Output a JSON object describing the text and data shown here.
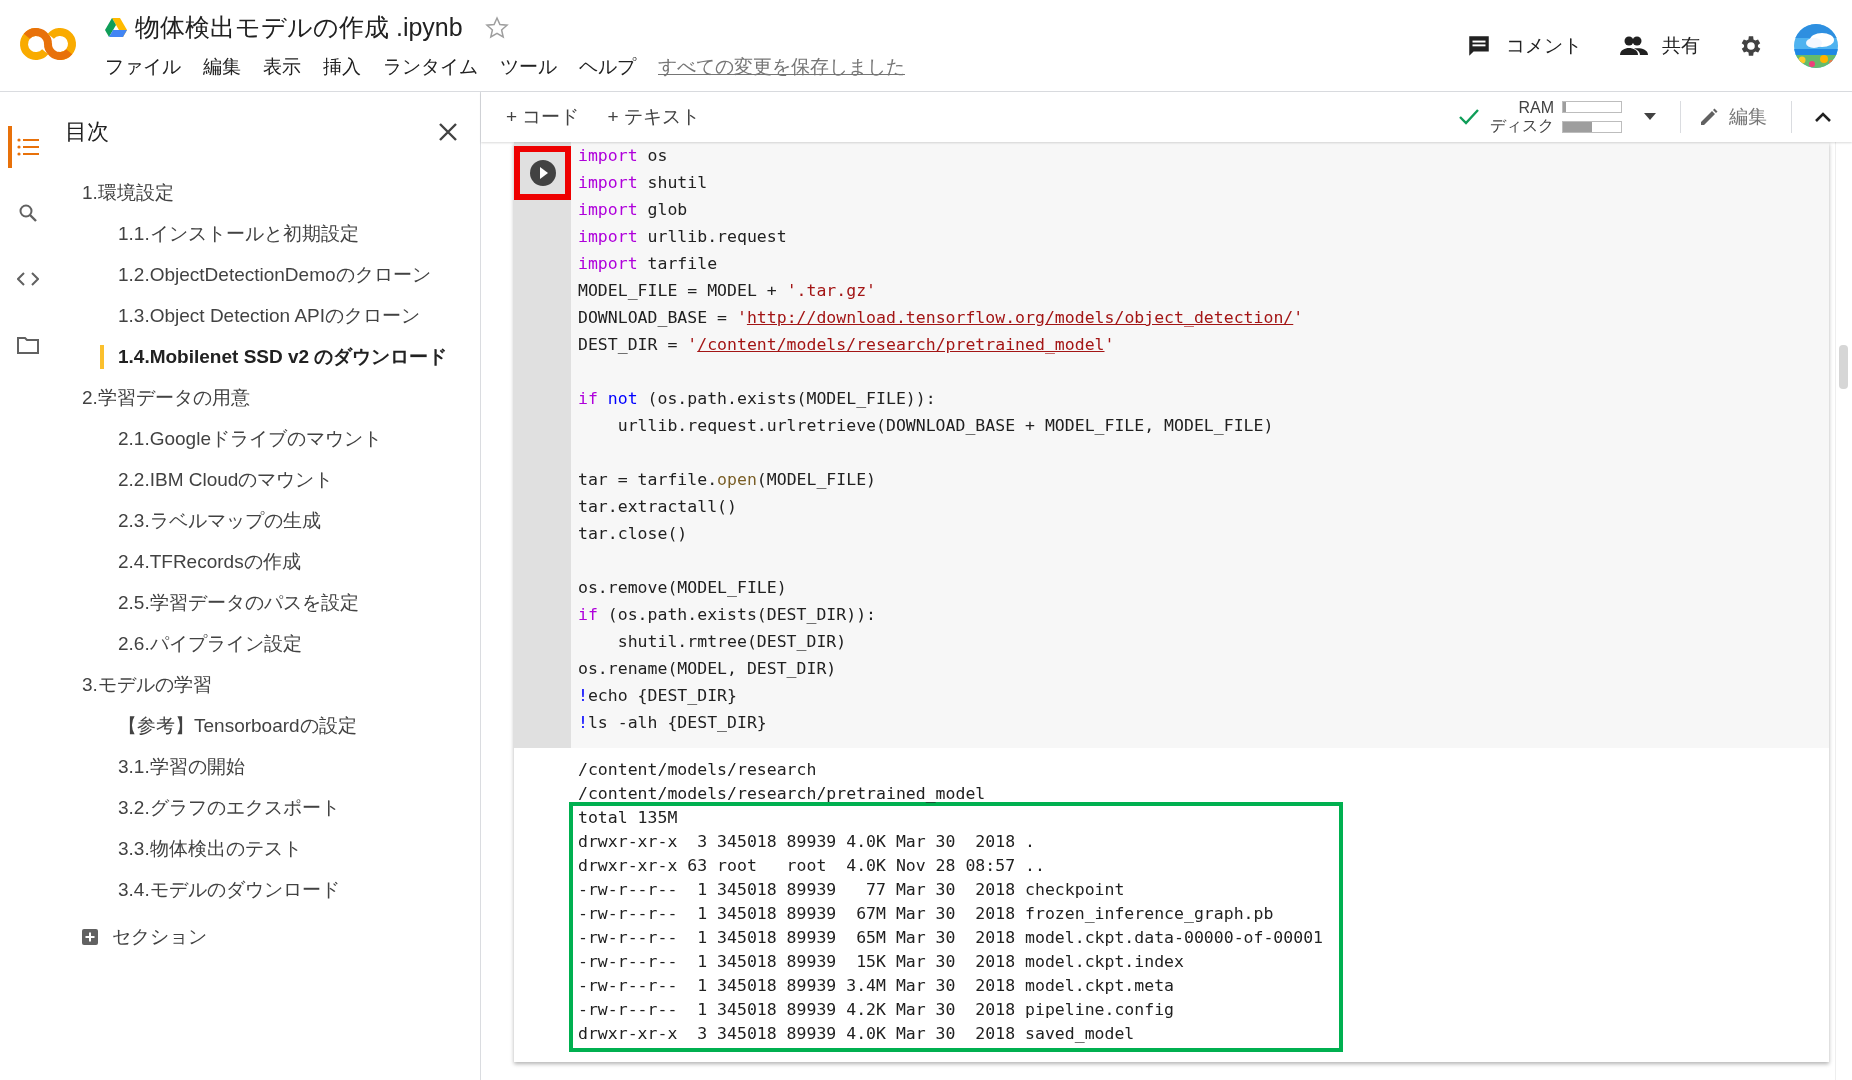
{
  "header": {
    "title": "物体検出モデルの作成 .ipynb",
    "starred": false,
    "menu": [
      "ファイル",
      "編集",
      "表示",
      "挿入",
      "ランタイム",
      "ツール",
      "ヘルプ"
    ],
    "save_status": "すべての変更を保存しました",
    "actions": [
      {
        "kind": "comment",
        "label": "コメント"
      },
      {
        "kind": "share",
        "label": "共有"
      },
      {
        "kind": "settings"
      }
    ]
  },
  "sidebar": {
    "rail": [
      {
        "kind": "toc",
        "selected": true
      },
      {
        "kind": "search",
        "selected": false
      },
      {
        "kind": "code",
        "selected": false
      },
      {
        "kind": "files",
        "selected": false
      }
    ],
    "title": "目次",
    "toc": [
      {
        "label": "1.環境設定",
        "selected": false,
        "children": [
          {
            "label": "1.1.インストールと初期設定",
            "selected": false
          },
          {
            "label": "1.2.ObjectDetectionDemoのクローン",
            "selected": false
          },
          {
            "label": "1.3.Object Detection APIのクローン",
            "selected": false
          },
          {
            "label": "1.4.Mobilenet SSD v2 のダウンロード",
            "selected": true
          }
        ]
      },
      {
        "label": "2.学習データの用意",
        "selected": false,
        "children": [
          {
            "label": "2.1.Googleドライブのマウント",
            "selected": false
          },
          {
            "label": "2.2.IBM Cloudのマウント",
            "selected": false
          },
          {
            "label": "2.3.ラベルマップの生成",
            "selected": false
          },
          {
            "label": "2.4.TFRecordsの作成",
            "selected": false
          },
          {
            "label": "2.5.学習データのパスを設定",
            "selected": false
          },
          {
            "label": "2.6.パイプライン設定",
            "selected": false
          }
        ]
      },
      {
        "label": "3.モデルの学習",
        "selected": false,
        "children": [
          {
            "label": "【参考】Tensorboardの設定",
            "selected": false
          },
          {
            "label": "3.1.学習の開始",
            "selected": false
          },
          {
            "label": "3.2.グラフのエクスポート",
            "selected": false
          },
          {
            "label": "3.3.物体検出のテスト",
            "selected": false
          },
          {
            "label": "3.4.モデルのダウンロード",
            "selected": false
          }
        ]
      }
    ],
    "add_section": "セクション"
  },
  "toolbar": {
    "add_buttons": [
      "+ コード",
      "+ テキスト"
    ],
    "runtime": {
      "connected": true,
      "ram_label": "RAM",
      "disk_label": "ディスク",
      "ram_level": {
        "level": 0.05
      },
      "disk_level": {
        "level": 0.5
      }
    },
    "edit_label": "編集"
  },
  "cell": {
    "run_highlighted": true,
    "code_blocks": [
      [
        [
          {
            "text": "import",
            "kind": "kw"
          },
          {
            "text": " os",
            "kind": "plain"
          }
        ],
        [
          {
            "text": "import",
            "kind": "kw"
          },
          {
            "text": " shutil",
            "kind": "plain"
          }
        ],
        [
          {
            "text": "import",
            "kind": "kw"
          },
          {
            "text": " glob",
            "kind": "plain"
          }
        ],
        [
          {
            "text": "import",
            "kind": "kw"
          },
          {
            "text": " urllib.request",
            "kind": "plain"
          }
        ],
        [
          {
            "text": "import",
            "kind": "kw"
          },
          {
            "text": " tarfile",
            "kind": "plain"
          }
        ],
        [
          {
            "text": "MODEL_FILE = MODEL + ",
            "kind": "plain"
          },
          {
            "text": "'.tar.gz'",
            "kind": "str"
          }
        ],
        [
          {
            "text": "DOWNLOAD_BASE = ",
            "kind": "plain"
          },
          {
            "text": "'",
            "kind": "str"
          },
          {
            "text": "http://download.tensorflow.org/models/object_detection/",
            "kind": "link"
          },
          {
            "text": "'",
            "kind": "str"
          }
        ],
        [
          {
            "text": "DEST_DIR = ",
            "kind": "plain"
          },
          {
            "text": "'",
            "kind": "str"
          },
          {
            "text": "/content/models/research/pretrained_model",
            "kind": "link"
          },
          {
            "text": "'",
            "kind": "str"
          }
        ]
      ],
      [
        [
          {
            "text": "if",
            "kind": "kw"
          },
          {
            "text": " not",
            "kind": "op"
          },
          {
            "text": " (os.path.exists(MODEL_FILE)):",
            "kind": "plain"
          }
        ],
        [
          {
            "text": "    urllib.request.urlretrieve(DOWNLOAD_BASE + MODEL_FILE, MODEL_FILE)",
            "kind": "plain"
          }
        ]
      ],
      [
        [
          {
            "text": "tar = tarfile.",
            "kind": "plain"
          },
          {
            "text": "open",
            "kind": "fn"
          },
          {
            "text": "(MODEL_FILE)",
            "kind": "plain"
          }
        ],
        [
          {
            "text": "tar.extractall()",
            "kind": "plain"
          }
        ],
        [
          {
            "text": "tar.close()",
            "kind": "plain"
          }
        ]
      ],
      [
        [
          {
            "text": "os.remove(MODEL_FILE)",
            "kind": "plain"
          }
        ],
        [
          {
            "text": "if",
            "kind": "kw"
          },
          {
            "text": " (os.path.exists(DEST_DIR)):",
            "kind": "plain"
          }
        ],
        [
          {
            "text": "    shutil.rmtree(DEST_DIR)",
            "kind": "plain"
          }
        ],
        [
          {
            "text": "os.rename(MODEL, DEST_DIR)",
            "kind": "plain"
          }
        ],
        [
          {
            "text": "!",
            "kind": "op"
          },
          {
            "text": "echo {DEST_DIR}",
            "kind": "plain"
          }
        ],
        [
          {
            "text": "!",
            "kind": "op"
          },
          {
            "text": "ls -alh {DEST_DIR}",
            "kind": "plain"
          }
        ]
      ]
    ],
    "output": {
      "lines": [
        "/content/models/research",
        "/content/models/research/pretrained_model"
      ],
      "highlighted_lines": [
        "total 135M",
        "drwxr-xr-x  3 345018 89939 4.0K Mar 30  2018 .",
        "drwxr-xr-x 63 root   root  4.0K Nov 28 08:57 ..",
        "-rw-r--r--  1 345018 89939   77 Mar 30  2018 checkpoint",
        "-rw-r--r--  1 345018 89939  67M Mar 30  2018 frozen_inference_graph.pb",
        "-rw-r--r--  1 345018 89939  65M Mar 30  2018 model.ckpt.data-00000-of-00001",
        "-rw-r--r--  1 345018 89939  15K Mar 30  2018 model.ckpt.index",
        "-rw-r--r--  1 345018 89939 3.4M Mar 30  2018 model.ckpt.meta",
        "-rw-r--r--  1 345018 89939 4.2K Mar 30  2018 pipeline.config",
        "drwxr-xr-x  3 345018 89939 4.0K Mar 30  2018 saved_model"
      ]
    }
  }
}
